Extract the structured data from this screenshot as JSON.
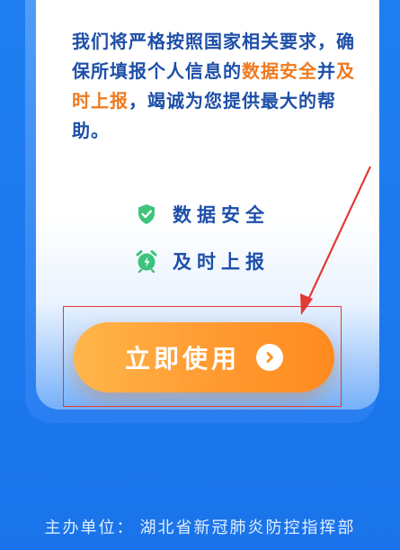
{
  "intro": {
    "part1": "我们将严格按照国家相关要求，确保所填报个人信息的",
    "highlight1": "数据安全",
    "conj": "并",
    "highlight2": "及时上报",
    "part2": "，竭诚为您提供最大的帮助。"
  },
  "features": [
    {
      "icon": "shield-check-icon",
      "label": "数据安全"
    },
    {
      "icon": "alarm-clock-icon",
      "label": "及时上报"
    }
  ],
  "cta": {
    "label": "立即使用",
    "icon": "chevron-right-circle-icon"
  },
  "footer": {
    "label": "主办单位：",
    "organizer": "湖北省新冠肺炎防控指挥部"
  },
  "colors": {
    "background": "#1f7ff0",
    "text_blue": "#1e4fa8",
    "accent_orange": "#f07a1e",
    "icon_green": "#3cc47c",
    "annotation_red": "#e53935"
  }
}
